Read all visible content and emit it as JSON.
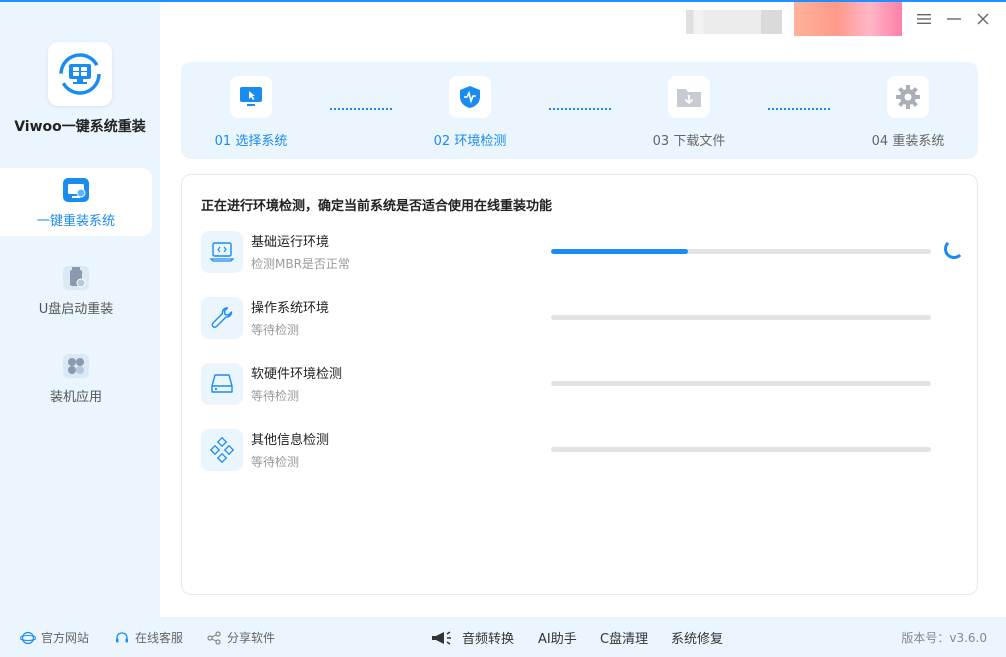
{
  "app": {
    "name": "Viwoo一键系统重装"
  },
  "sidebar": {
    "items": [
      {
        "label": "一键重装系统",
        "icon": "monitor-reinstall-icon",
        "active": true
      },
      {
        "label": "U盘启动重装",
        "icon": "usb-drive-icon",
        "active": false
      },
      {
        "label": "装机应用",
        "icon": "apps-icon",
        "active": false
      }
    ]
  },
  "steps": [
    {
      "label": "01 选择系统",
      "icon": "select-screen-icon",
      "state": "done"
    },
    {
      "label": "02 环境检测",
      "icon": "shield-check-icon",
      "state": "done"
    },
    {
      "label": "03 下载文件",
      "icon": "download-folder-icon",
      "state": "pending"
    },
    {
      "label": "04 重装系统",
      "icon": "gear-icon",
      "state": "pending"
    }
  ],
  "main": {
    "title": "正在进行环境检测，确定当前系统是否适合使用在线重装功能",
    "checks": [
      {
        "name": "基础运行环境",
        "status": "检测MBR是否正常",
        "progress": 0.36,
        "icon": "laptop-code-icon",
        "loading": true
      },
      {
        "name": "操作系统环境",
        "status": "等待检测",
        "progress": 0,
        "icon": "wrench-icon",
        "loading": false
      },
      {
        "name": "软硬件环境检测",
        "status": "等待检测",
        "progress": 0,
        "icon": "hard-drive-icon",
        "loading": false
      },
      {
        "name": "其他信息检测",
        "status": "等待检测",
        "progress": 0,
        "icon": "diamond-grid-icon",
        "loading": false
      }
    ]
  },
  "footer": {
    "links": [
      {
        "label": "官方网站",
        "icon": "globe-icon"
      },
      {
        "label": "在线客服",
        "icon": "headset-icon"
      },
      {
        "label": "分享软件",
        "icon": "share-icon"
      }
    ],
    "tools": [
      {
        "label": "音频转换",
        "icon": "megaphone-icon"
      },
      {
        "label": "AI助手"
      },
      {
        "label": "C盘清理"
      },
      {
        "label": "系统修复"
      }
    ],
    "version": "版本号：v3.6.0"
  },
  "colors": {
    "accent": "#1a8cf0",
    "panel": "#eaf5fd"
  }
}
